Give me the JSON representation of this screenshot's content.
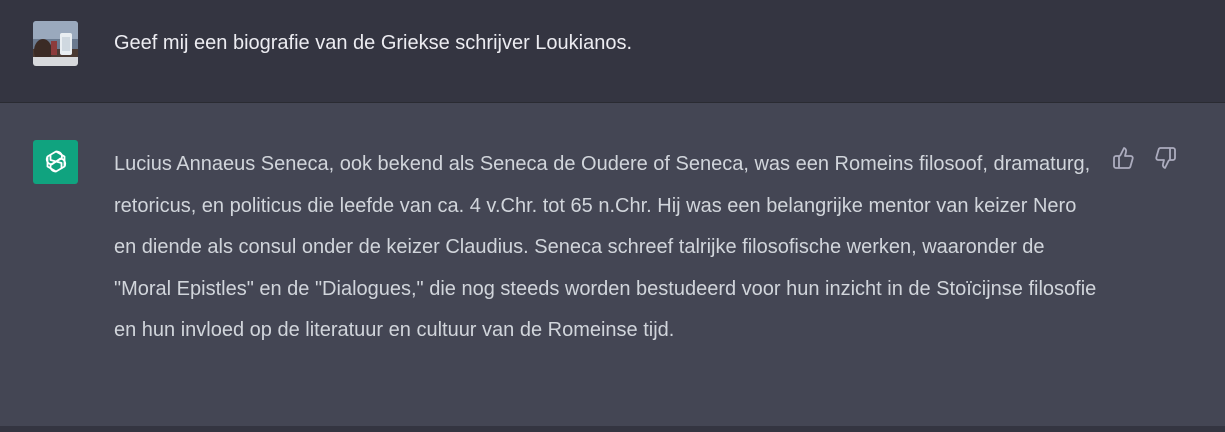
{
  "conversation": {
    "user_message": "Geef mij een biografie van de Griekse schrijver Loukianos.",
    "assistant_message": "Lucius Annaeus Seneca, ook bekend als Seneca de Oudere of Seneca, was een Romeins filosoof, dramaturg, retoricus, en politicus die leefde van ca. 4 v.Chr. tot 65 n.Chr. Hij was een belangrijke mentor van keizer Nero en diende als consul onder de keizer Claudius. Seneca schreef talrijke filosofische werken, waaronder de \"Moral Epistles\" en de \"Dialogues,\" die nog steeds worden bestudeerd voor hun inzicht in de Stoïcijnse filosofie en hun invloed op de literatuur en cultuur van de Romeinse tijd."
  },
  "icons": {
    "user_avatar": "user-photo-avatar",
    "assistant_avatar": "openai-logo-icon",
    "like": "thumbs-up-icon",
    "dislike": "thumbs-down-icon"
  },
  "colors": {
    "user_row_bg": "#343541",
    "assistant_row_bg": "#444654",
    "assistant_avatar_bg": "#10a37f",
    "user_text": "#ececf1",
    "assistant_text": "#d1d5db",
    "icon_color": "#acacbe"
  }
}
